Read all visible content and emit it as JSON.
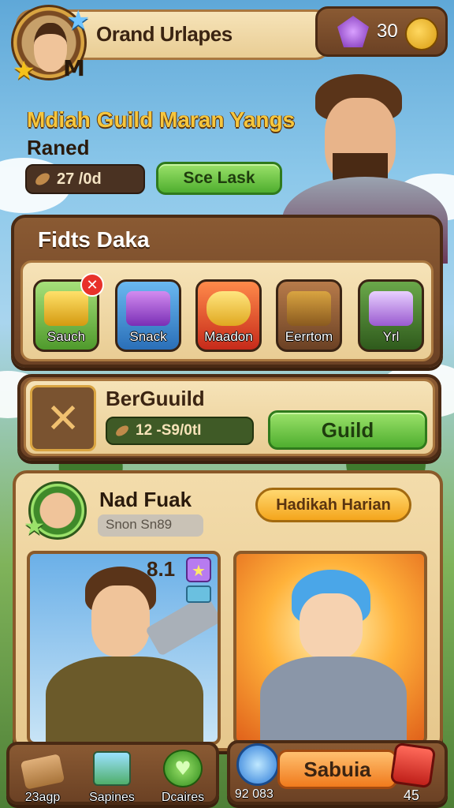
{
  "header": {
    "player_initial": "M",
    "title": "Orand Urlapes",
    "gems": "30"
  },
  "guild_info": {
    "name": "Mdiah Guild Maran Yangs",
    "rank": "Raned",
    "stat": "27 /0d",
    "action": "Sce Lask"
  },
  "feeds": {
    "title": "Fidts Daka",
    "items": [
      {
        "label": "Sauch"
      },
      {
        "label": "Snack"
      },
      {
        "label": "Maadon"
      },
      {
        "label": "Eerrtom"
      },
      {
        "label": "Yrl"
      }
    ]
  },
  "guild_panel": {
    "title": "BerGuuild",
    "stat": "12 -S9/0tI",
    "button": "Guild"
  },
  "profile": {
    "name": "Nad Fuak",
    "sub": "Snon Sn89",
    "daily_button": "Hadikah Harian",
    "card_stat": "8.1"
  },
  "bottom_nav": {
    "items": [
      {
        "label": "23agp"
      },
      {
        "label": "Sapines"
      },
      {
        "label": "Dcaires"
      }
    ],
    "currency_value": "92 083",
    "main_button": "Sabuia",
    "dice_value": "45"
  }
}
